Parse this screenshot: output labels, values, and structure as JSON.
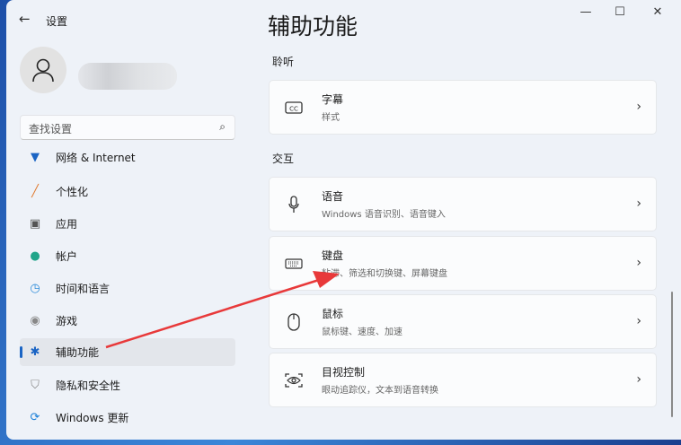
{
  "window": {
    "title": "设置",
    "minimize": "—",
    "maximize": "☐",
    "close": "✕"
  },
  "sidebar": {
    "search_placeholder": "查找设置",
    "items": [
      {
        "label": "网络 & Internet"
      },
      {
        "label": "个性化"
      },
      {
        "label": "应用"
      },
      {
        "label": "帐户"
      },
      {
        "label": "时间和语言"
      },
      {
        "label": "游戏"
      },
      {
        "label": "辅助功能",
        "selected": true
      },
      {
        "label": "隐私和安全性"
      },
      {
        "label": "Windows 更新"
      }
    ]
  },
  "main": {
    "title": "辅助功能",
    "sections": [
      {
        "label": "聆听",
        "cards": [
          {
            "title": "字幕",
            "subtitle": "样式"
          }
        ]
      },
      {
        "label": "交互",
        "cards": [
          {
            "title": "语音",
            "subtitle": "Windows 语音识别、语音键入"
          },
          {
            "title": "键盘",
            "subtitle": "粘滞、筛选和切换键、屏幕键盘"
          },
          {
            "title": "鼠标",
            "subtitle": "鼠标键、速度、加速"
          },
          {
            "title": "目视控制",
            "subtitle": "眼动追踪仪，文本到语音转换"
          }
        ]
      }
    ]
  },
  "colors": {
    "accent": "#1a64c4",
    "annotation_arrow": "#e8393a"
  }
}
